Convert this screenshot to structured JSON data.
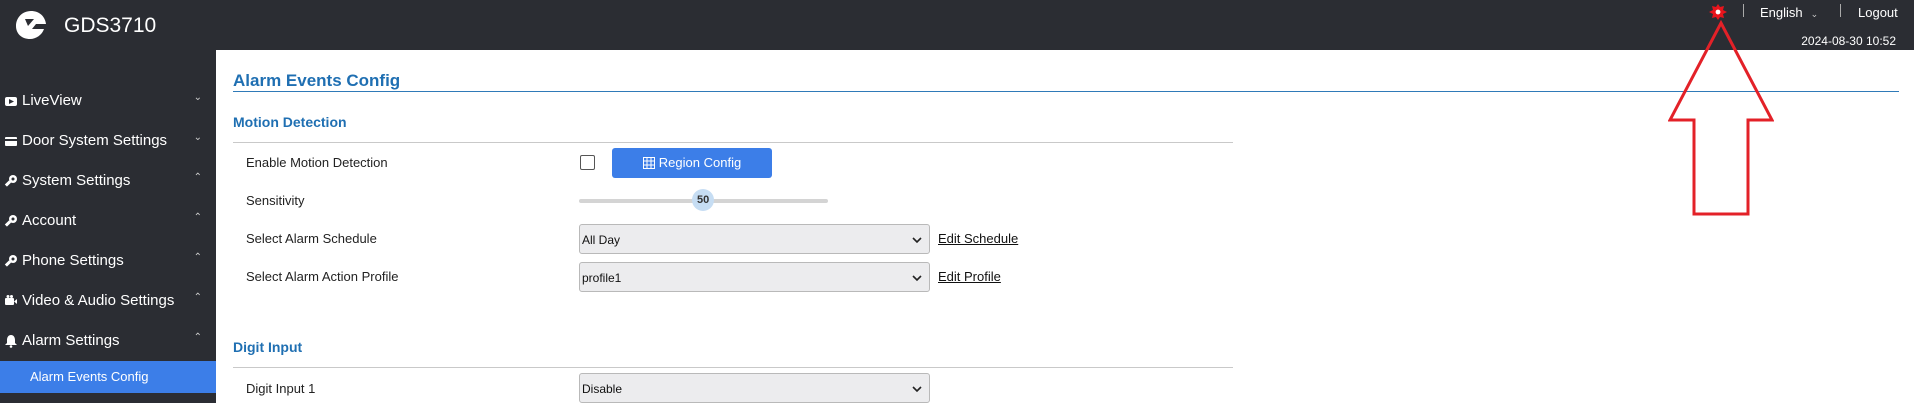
{
  "header": {
    "brand": "GDS3710",
    "language": "English",
    "logout": "Logout",
    "datetime": "2024-08-30 10:52",
    "alert_icon": "alert-gear-icon",
    "alert_color": "#e8141c"
  },
  "sidebar": {
    "items": [
      {
        "label": "LiveView",
        "icon": "video-icon",
        "caret": "⌄"
      },
      {
        "label": "Door System Settings",
        "icon": "card-icon",
        "caret": "⌄"
      },
      {
        "label": "System Settings",
        "icon": "wrench-icon",
        "caret": "⌃"
      },
      {
        "label": "Account",
        "icon": "key-icon",
        "caret": "⌃"
      },
      {
        "label": "Phone Settings",
        "icon": "phone-icon",
        "caret": "⌃"
      },
      {
        "label": "Video & Audio Settings",
        "icon": "video-camera-icon",
        "caret": "⌃"
      },
      {
        "label": "Alarm Settings",
        "icon": "bell-icon",
        "caret": "⌃"
      }
    ],
    "active_sub": "Alarm Events Config",
    "active_color": "#3c7ee8"
  },
  "main": {
    "title": "Alarm Events Config",
    "motion": {
      "section": "Motion Detection",
      "enable_label": "Enable Motion Detection",
      "enable_checked": false,
      "region_button": "Region Config",
      "sensitivity_label": "Sensitivity",
      "sensitivity_value": "50",
      "sensitivity_min": 0,
      "sensitivity_max": 100,
      "schedule_label": "Select Alarm Schedule",
      "schedule_value": "All Day",
      "edit_schedule": "Edit Schedule",
      "profile_label": "Select Alarm Action Profile",
      "profile_value": "profile1",
      "edit_profile": "Edit Profile"
    },
    "digit": {
      "section": "Digit Input",
      "input1_label": "Digit Input 1",
      "input1_value": "Disable"
    }
  }
}
